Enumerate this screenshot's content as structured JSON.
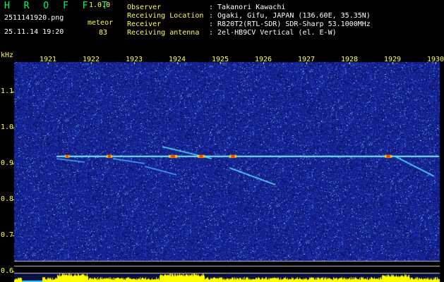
{
  "app": {
    "title": "H R O F F T",
    "version": "1.0.0"
  },
  "file": {
    "name": "2511141920.png",
    "datetime": "25.11.14 19:20"
  },
  "meteor": {
    "label": "meteor",
    "count": "83"
  },
  "info": {
    "observer_label": "Observer",
    "observer_value": ": Takanori Kawachi",
    "location_label": "Receiving Location",
    "location_value": ": Ogaki, Gifu, JAPAN (136.60E, 35.35N)",
    "receiver_label": "Receiver",
    "receiver_value": ": R820T2(RTL-SDR) SDR-Sharp 53.1000MHz",
    "antenna_label": "Receiving antenna",
    "antenna_value": ": 2el-HB9CV Vertical (el. E-W)"
  },
  "chart_data": {
    "type": "heatmap",
    "ylabel_unit": "kHz",
    "x_ticks": [
      "1921",
      "1922",
      "1923",
      "1924",
      "1925",
      "1926",
      "1927",
      "1928",
      "1929",
      "1930"
    ],
    "y_ticks": [
      "1.1",
      "1.0",
      "0.9",
      "0.8",
      "0.7",
      "0.6"
    ],
    "carrier_khz": 0.92,
    "colors": {
      "background": "#1a2a8f",
      "carrier": "#33ccff",
      "hot": "#ff3300",
      "level_bar": "#ffff00"
    }
  }
}
